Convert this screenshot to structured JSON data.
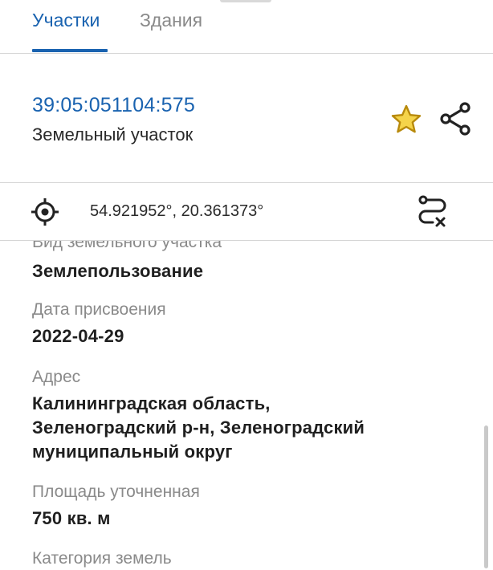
{
  "tabs": [
    {
      "label": "Участки",
      "active": true
    },
    {
      "label": "Здания",
      "active": false
    }
  ],
  "parcel": {
    "cadastral_number": "39:05:051104:575",
    "type": "Земельный участок"
  },
  "coords": {
    "text": "54.921952°, 20.361373°"
  },
  "details": {
    "kind_label": "Вид земельного участка",
    "kind_value": "Землепользование",
    "date_label": "Дата присвоения",
    "date_value": "2022-04-29",
    "address_label": "Адрес",
    "address_line1": "Калининградская область,",
    "address_line2": "Зеленоградский р-н, Зеленоградский",
    "address_line3": "муниципальный округ",
    "area_label": "Площадь уточненная",
    "area_value": "750 кв. м",
    "category_label": "Категория земель"
  },
  "icons": {
    "favorite": "star-icon",
    "share": "share-icon",
    "location": "target-icon",
    "route": "route-clear-icon"
  },
  "colors": {
    "accent": "#1a63b0",
    "star_fill": "#f5d44a",
    "star_stroke": "#b88a0c",
    "muted_text": "#8a8a8a",
    "divider": "#d6d6d6"
  }
}
